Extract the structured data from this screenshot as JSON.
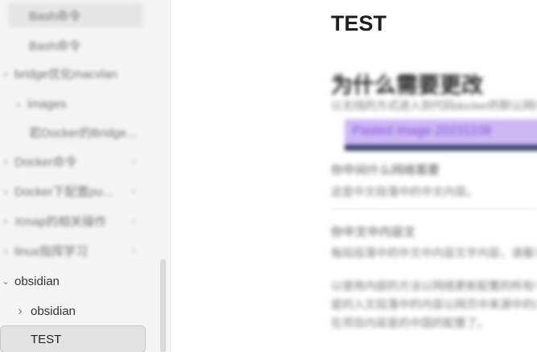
{
  "sidebar": {
    "items": [
      {
        "label": "Bash命令",
        "indent": 2
      },
      {
        "label": "Bash命令",
        "indent": 2
      },
      {
        "label": "bridge优化macvlan",
        "indent": 1
      },
      {
        "label": "images",
        "indent": 2
      },
      {
        "label": "若Docker的Bridge...",
        "indent": 2
      },
      {
        "label": "Docker命令",
        "indent": 1
      },
      {
        "label": "Docker下配置pu...",
        "indent": 1
      },
      {
        "label": "Xmap的相关操作",
        "indent": 1
      },
      {
        "label": "linux指挥学习",
        "indent": 1
      }
    ],
    "folder": {
      "label": "obsidian"
    },
    "subfolder": {
      "label": "obsidian"
    },
    "selected": {
      "label": "TEST"
    }
  },
  "main": {
    "title": "TEST",
    "heading": "为什么需要更改",
    "intro": "以无线的方式进入到代码docker的默认网络配置中，默认情况下",
    "embed_link": "Pasted image 20231108",
    "q1": "你中间什么网络需要",
    "q1_text": "这是中文段落中的中文内容。",
    "q2": "你中文中内容文",
    "q2_text": "每段段落中的中文中内容文字内容，请看看内容的展示",
    "p1": "以使用内部的方法以网络更新配置的所有中文中文内容显示",
    "p2": "是的入文段落中的内容以网页中来源中的内容显示的",
    "p3": "在项目内容是的中国的配置了。"
  }
}
